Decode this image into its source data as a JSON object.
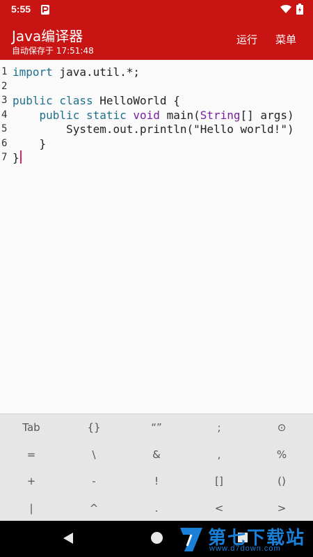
{
  "status_bar": {
    "time": "5:55"
  },
  "app_bar": {
    "title": "Java编译器",
    "subtitle": "自动保存于 17:51:48",
    "run_label": "运行",
    "menu_label": "菜单"
  },
  "editor": {
    "line_numbers": [
      "1",
      "2",
      "3",
      "4",
      "5",
      "6",
      "7"
    ],
    "lines": [
      [
        "import",
        " java.util.*;"
      ],
      [
        "",
        ""
      ],
      [
        "public class",
        " HelloWorld {"
      ],
      [
        "    public static",
        " ",
        "void",
        " main(",
        "String",
        "[] args)"
      ],
      [
        "",
        "        System.out.println(\"Hello world!\")"
      ],
      [
        "",
        "    }"
      ],
      [
        "",
        "}"
      ]
    ]
  },
  "keyboard": {
    "rows": [
      [
        "Tab",
        "{}",
        "“”",
        ";",
        "⊙"
      ],
      [
        "=",
        "\\",
        "&",
        ",",
        "%"
      ],
      [
        "+",
        "-",
        "!",
        "[]",
        "()"
      ],
      [
        "|",
        "^",
        ".",
        "<",
        ">"
      ]
    ]
  },
  "watermark": {
    "name": "第七下载站",
    "url": "www.d7down.com"
  },
  "colors": {
    "accent": "#c91414",
    "keyword": "#1f6f8b",
    "type": "#7b1fa2",
    "caret": "#e0245e",
    "watermark": "#1a7fd6"
  }
}
